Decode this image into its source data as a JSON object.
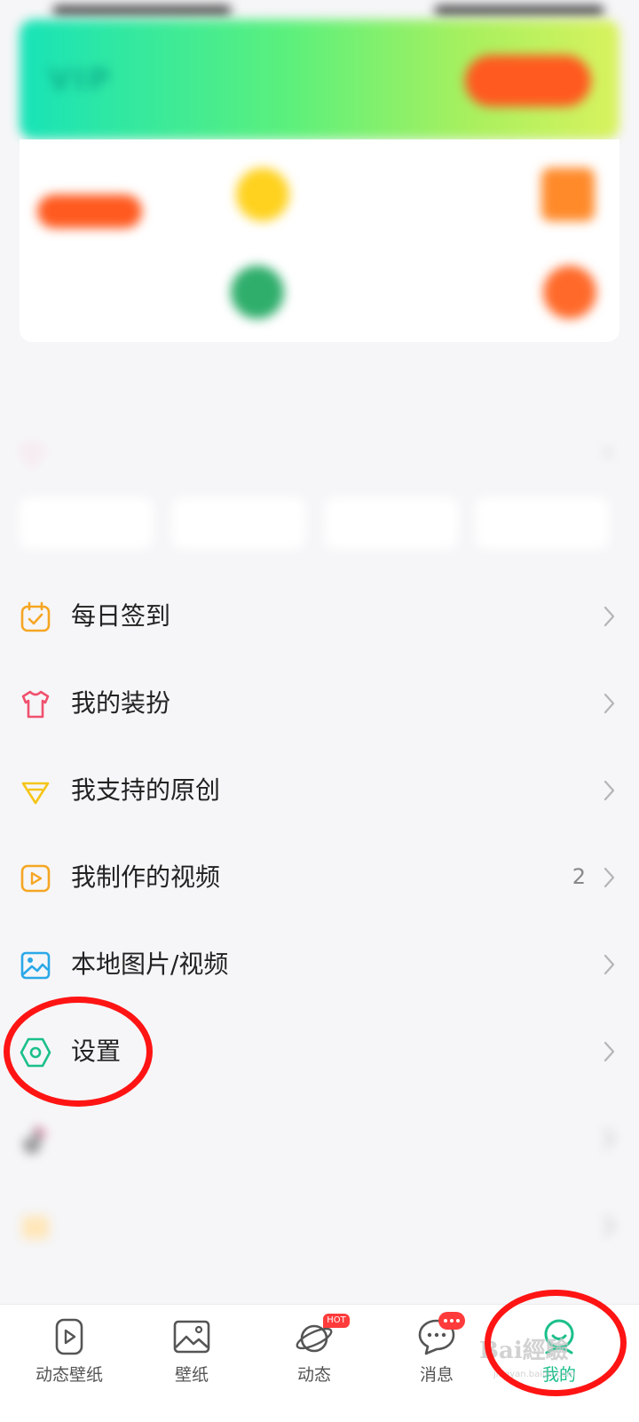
{
  "colors": {
    "accent": "#1bbf8a",
    "badge": "#ff3b3b",
    "vip_button": "#ff5a1f",
    "annotation": "#ff1414"
  },
  "blurred_header": {
    "vip_banner": {
      "logo": "VIP",
      "text1": "",
      "text2": "",
      "button": ""
    },
    "cards": [
      {
        "title": "",
        "pill": "",
        "icon": "coin-icon"
      },
      {
        "title": "",
        "sub": "",
        "icon": "gift-icon"
      },
      {
        "title": "",
        "sub": "",
        "icon": "badge-icon"
      },
      {
        "title": "",
        "sub": "",
        "icon": "crown-icon"
      }
    ],
    "common_section_title": "",
    "favorites_label": "",
    "chips": [
      "",
      "",
      "",
      ""
    ]
  },
  "menu": [
    {
      "label": "每日签到",
      "icon": "calendar-check-icon",
      "count": ""
    },
    {
      "label": "我的装扮",
      "icon": "shirt-icon",
      "count": ""
    },
    {
      "label": "我支持的原创",
      "icon": "diamond-icon",
      "count": ""
    },
    {
      "label": "我制作的视频",
      "icon": "video-play-icon",
      "count": "2"
    },
    {
      "label": "本地图片/视频",
      "icon": "image-icon",
      "count": ""
    },
    {
      "label": "设置",
      "icon": "settings-hex-icon",
      "count": ""
    },
    {
      "label": "",
      "icon": "tiktok-icon",
      "count": ""
    },
    {
      "label": "",
      "icon": "folder-icon",
      "count": ""
    }
  ],
  "bottom_nav": [
    {
      "label": "动态壁纸",
      "icon": "live-wallpaper-icon",
      "active": false
    },
    {
      "label": "壁纸",
      "icon": "wallpaper-icon",
      "active": false
    },
    {
      "label": "动态",
      "icon": "planet-icon",
      "active": false,
      "badge": "HOT"
    },
    {
      "label": "消息",
      "icon": "chat-icon",
      "active": false,
      "badge": "•••"
    },
    {
      "label": "我的",
      "icon": "profile-icon",
      "active": true
    }
  ],
  "watermark": {
    "main": "Bai經驗",
    "sub": "jingyan.baidu.com"
  }
}
